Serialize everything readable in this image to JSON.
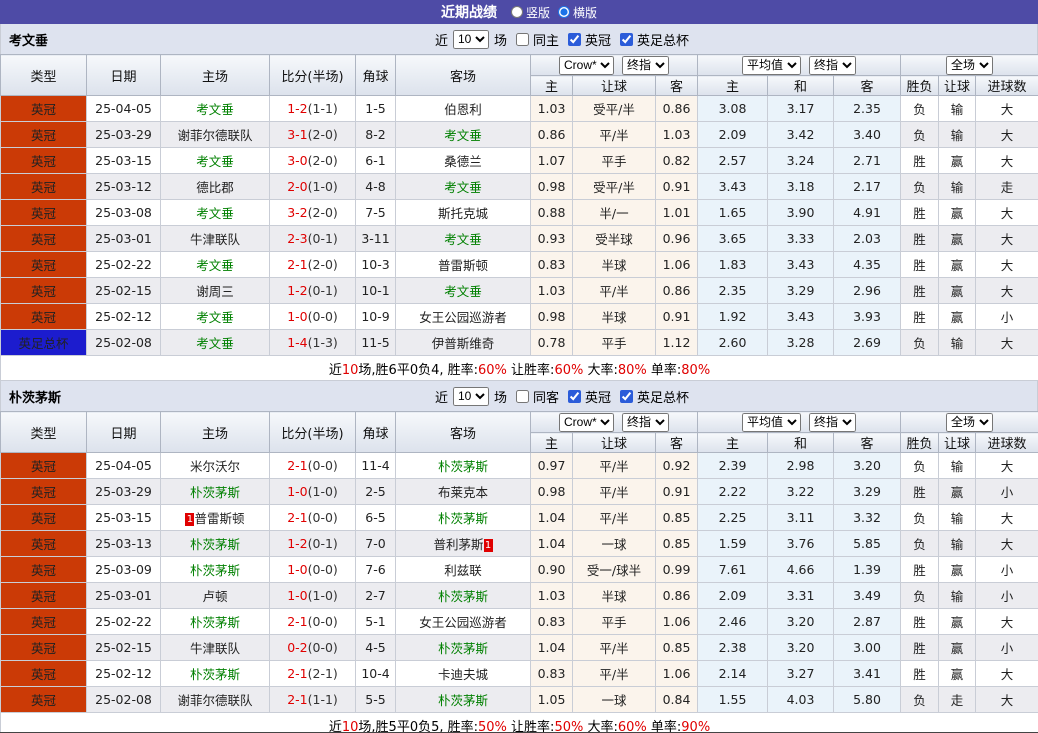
{
  "title_bar": {
    "title": "近期战绩",
    "radio_vertical": "竖版",
    "radio_horizontal": "横版",
    "selected": "横版"
  },
  "columns": {
    "left": [
      "类型",
      "日期",
      "主场",
      "比分(半场)",
      "角球",
      "客场"
    ],
    "handicap": [
      "主",
      "让球",
      "客"
    ],
    "europe": [
      "主",
      "和",
      "客"
    ],
    "result": [
      "胜负",
      "让球",
      "进球数"
    ]
  },
  "dropdowns": {
    "handicap_source": "Crow*",
    "handicap_final": "终指",
    "europe_source": "平均值",
    "europe_final": "终指",
    "scope": "全场"
  },
  "colors": {
    "accent_purple": "#4E4BA6",
    "badge_league": "#CB3A06",
    "badge_cup": "#1C1CCE",
    "focus_team_green": "#008000",
    "score_red": "#E00000",
    "win_red": "#DC4B42",
    "lose_blue": "#3B35CE",
    "push_green": "#2BA02B"
  },
  "teams": [
    {
      "name": "考文垂",
      "filter": {
        "near": "近",
        "games": "10",
        "unit": "场",
        "same": "同主",
        "same_checked": false,
        "league": "英冠",
        "league_checked": true,
        "cup": "英足总杯",
        "cup_checked": true
      },
      "rows": [
        {
          "league": "英冠",
          "league_style": "o",
          "date": "25-04-05",
          "home": "考文垂",
          "home_focus": true,
          "home_rc": "",
          "score": "1-2",
          "half": "(1-1)",
          "corner": "1-5",
          "away": "伯恩利",
          "away_focus": false,
          "away_rc": "",
          "h": [
            "1.03",
            "受平/半",
            "0.86"
          ],
          "e": [
            "3.08",
            "3.17",
            "2.35"
          ],
          "res": [
            [
              "负",
              "b"
            ],
            [
              "输",
              "b"
            ],
            [
              "大",
              "r"
            ]
          ]
        },
        {
          "league": "英冠",
          "league_style": "o",
          "date": "25-03-29",
          "home": "谢菲尔德联队",
          "home_focus": false,
          "home_rc": "",
          "score": "3-1",
          "half": "(2-0)",
          "corner": "8-2",
          "away": "考文垂",
          "away_focus": true,
          "away_rc": "",
          "h": [
            "0.86",
            "平/半",
            "1.03"
          ],
          "e": [
            "2.09",
            "3.42",
            "3.40"
          ],
          "res": [
            [
              "负",
              "b"
            ],
            [
              "输",
              "b"
            ],
            [
              "大",
              "r"
            ]
          ]
        },
        {
          "league": "英冠",
          "league_style": "o",
          "date": "25-03-15",
          "home": "考文垂",
          "home_focus": true,
          "home_rc": "",
          "score": "3-0",
          "half": "(2-0)",
          "corner": "6-1",
          "away": "桑德兰",
          "away_focus": false,
          "away_rc": "",
          "h": [
            "1.07",
            "平手",
            "0.82"
          ],
          "e": [
            "2.57",
            "3.24",
            "2.71"
          ],
          "res": [
            [
              "胜",
              "r"
            ],
            [
              "赢",
              "r"
            ],
            [
              "大",
              "r"
            ]
          ]
        },
        {
          "league": "英冠",
          "league_style": "o",
          "date": "25-03-12",
          "home": "德比郡",
          "home_focus": false,
          "home_rc": "",
          "score": "2-0",
          "half": "(1-0)",
          "corner": "4-8",
          "away": "考文垂",
          "away_focus": true,
          "away_rc": "",
          "h": [
            "0.98",
            "受平/半",
            "0.91"
          ],
          "e": [
            "3.43",
            "3.18",
            "2.17"
          ],
          "res": [
            [
              "负",
              "b"
            ],
            [
              "输",
              "b"
            ],
            [
              "走",
              "g"
            ]
          ]
        },
        {
          "league": "英冠",
          "league_style": "o",
          "date": "25-03-08",
          "home": "考文垂",
          "home_focus": true,
          "home_rc": "",
          "score": "3-2",
          "half": "(2-0)",
          "corner": "7-5",
          "away": "斯托克城",
          "away_focus": false,
          "away_rc": "",
          "h": [
            "0.88",
            "半/一",
            "1.01"
          ],
          "e": [
            "1.65",
            "3.90",
            "4.91"
          ],
          "res": [
            [
              "胜",
              "r"
            ],
            [
              "赢",
              "r"
            ],
            [
              "大",
              "r"
            ]
          ]
        },
        {
          "league": "英冠",
          "league_style": "o",
          "date": "25-03-01",
          "home": "牛津联队",
          "home_focus": false,
          "home_rc": "",
          "score": "2-3",
          "half": "(0-1)",
          "corner": "3-11",
          "away": "考文垂",
          "away_focus": true,
          "away_rc": "",
          "h": [
            "0.93",
            "受半球",
            "0.96"
          ],
          "e": [
            "3.65",
            "3.33",
            "2.03"
          ],
          "res": [
            [
              "胜",
              "r"
            ],
            [
              "赢",
              "r"
            ],
            [
              "大",
              "r"
            ]
          ]
        },
        {
          "league": "英冠",
          "league_style": "o",
          "date": "25-02-22",
          "home": "考文垂",
          "home_focus": true,
          "home_rc": "",
          "score": "2-1",
          "half": "(2-0)",
          "corner": "10-3",
          "away": "普雷斯顿",
          "away_focus": false,
          "away_rc": "",
          "h": [
            "0.83",
            "半球",
            "1.06"
          ],
          "e": [
            "1.83",
            "3.43",
            "4.35"
          ],
          "res": [
            [
              "胜",
              "r"
            ],
            [
              "赢",
              "r"
            ],
            [
              "大",
              "r"
            ]
          ]
        },
        {
          "league": "英冠",
          "league_style": "o",
          "date": "25-02-15",
          "home": "谢周三",
          "home_focus": false,
          "home_rc": "",
          "score": "1-2",
          "half": "(0-1)",
          "corner": "10-1",
          "away": "考文垂",
          "away_focus": true,
          "away_rc": "",
          "h": [
            "1.03",
            "平/半",
            "0.86"
          ],
          "e": [
            "2.35",
            "3.29",
            "2.96"
          ],
          "res": [
            [
              "胜",
              "r"
            ],
            [
              "赢",
              "r"
            ],
            [
              "大",
              "r"
            ]
          ]
        },
        {
          "league": "英冠",
          "league_style": "o",
          "date": "25-02-12",
          "home": "考文垂",
          "home_focus": true,
          "home_rc": "",
          "score": "1-0",
          "half": "(0-0)",
          "corner": "10-9",
          "away": "女王公园巡游者",
          "away_focus": false,
          "away_rc": "",
          "h": [
            "0.98",
            "半球",
            "0.91"
          ],
          "e": [
            "1.92",
            "3.43",
            "3.93"
          ],
          "res": [
            [
              "胜",
              "r"
            ],
            [
              "赢",
              "r"
            ],
            [
              "小",
              "b"
            ]
          ]
        },
        {
          "league": "英足总杯",
          "league_style": "b",
          "date": "25-02-08",
          "home": "考文垂",
          "home_focus": true,
          "home_rc": "",
          "score": "1-4",
          "half": "(1-3)",
          "corner": "11-5",
          "away": "伊普斯维奇",
          "away_focus": false,
          "away_rc": "",
          "h": [
            "0.78",
            "平手",
            "1.12"
          ],
          "e": [
            "2.60",
            "3.28",
            "2.69"
          ],
          "res": [
            [
              "负",
              "b"
            ],
            [
              "输",
              "b"
            ],
            [
              "大",
              "r"
            ]
          ]
        }
      ],
      "summary": [
        [
          "近",
          "k"
        ],
        [
          "10",
          "r"
        ],
        [
          "场,胜6平0负4, 胜率:",
          "k"
        ],
        [
          "60%",
          "r"
        ],
        [
          " 让胜率:",
          "k"
        ],
        [
          "60%",
          "r"
        ],
        [
          " 大率:",
          "k"
        ],
        [
          "80%",
          "r"
        ],
        [
          " 单率:",
          "k"
        ],
        [
          "80%",
          "r"
        ]
      ]
    },
    {
      "name": "朴茨茅斯",
      "filter": {
        "near": "近",
        "games": "10",
        "unit": "场",
        "same": "同客",
        "same_checked": false,
        "league": "英冠",
        "league_checked": true,
        "cup": "英足总杯",
        "cup_checked": true
      },
      "rows": [
        {
          "league": "英冠",
          "league_style": "o",
          "date": "25-04-05",
          "home": "米尔沃尔",
          "home_focus": false,
          "home_rc": "",
          "score": "2-1",
          "half": "(0-0)",
          "corner": "11-4",
          "away": "朴茨茅斯",
          "away_focus": true,
          "away_rc": "",
          "h": [
            "0.97",
            "平/半",
            "0.92"
          ],
          "e": [
            "2.39",
            "2.98",
            "3.20"
          ],
          "res": [
            [
              "负",
              "b"
            ],
            [
              "输",
              "b"
            ],
            [
              "大",
              "r"
            ]
          ]
        },
        {
          "league": "英冠",
          "league_style": "o",
          "date": "25-03-29",
          "home": "朴茨茅斯",
          "home_focus": true,
          "home_rc": "",
          "score": "1-0",
          "half": "(1-0)",
          "corner": "2-5",
          "away": "布莱克本",
          "away_focus": false,
          "away_rc": "",
          "h": [
            "0.98",
            "平/半",
            "0.91"
          ],
          "e": [
            "2.22",
            "3.22",
            "3.29"
          ],
          "res": [
            [
              "胜",
              "r"
            ],
            [
              "赢",
              "r"
            ],
            [
              "小",
              "b"
            ]
          ]
        },
        {
          "league": "英冠",
          "league_style": "o",
          "date": "25-03-15",
          "home": "普雷斯顿",
          "home_focus": false,
          "home_rc": "1",
          "score": "2-1",
          "half": "(0-0)",
          "corner": "6-5",
          "away": "朴茨茅斯",
          "away_focus": true,
          "away_rc": "",
          "h": [
            "1.04",
            "平/半",
            "0.85"
          ],
          "e": [
            "2.25",
            "3.11",
            "3.32"
          ],
          "res": [
            [
              "负",
              "b"
            ],
            [
              "输",
              "b"
            ],
            [
              "大",
              "r"
            ]
          ]
        },
        {
          "league": "英冠",
          "league_style": "o",
          "date": "25-03-13",
          "home": "朴茨茅斯",
          "home_focus": true,
          "home_rc": "",
          "score": "1-2",
          "half": "(0-1)",
          "corner": "7-0",
          "away": "普利茅斯",
          "away_focus": false,
          "away_rc": "1",
          "h": [
            "1.04",
            "一球",
            "0.85"
          ],
          "e": [
            "1.59",
            "3.76",
            "5.85"
          ],
          "res": [
            [
              "负",
              "b"
            ],
            [
              "输",
              "b"
            ],
            [
              "大",
              "r"
            ]
          ]
        },
        {
          "league": "英冠",
          "league_style": "o",
          "date": "25-03-09",
          "home": "朴茨茅斯",
          "home_focus": true,
          "home_rc": "",
          "score": "1-0",
          "half": "(0-0)",
          "corner": "7-6",
          "away": "利兹联",
          "away_focus": false,
          "away_rc": "",
          "h": [
            "0.90",
            "受一/球半",
            "0.99"
          ],
          "e": [
            "7.61",
            "4.66",
            "1.39"
          ],
          "res": [
            [
              "胜",
              "r"
            ],
            [
              "赢",
              "r"
            ],
            [
              "小",
              "b"
            ]
          ]
        },
        {
          "league": "英冠",
          "league_style": "o",
          "date": "25-03-01",
          "home": "卢顿",
          "home_focus": false,
          "home_rc": "",
          "score": "1-0",
          "half": "(1-0)",
          "corner": "2-7",
          "away": "朴茨茅斯",
          "away_focus": true,
          "away_rc": "",
          "h": [
            "1.03",
            "半球",
            "0.86"
          ],
          "e": [
            "2.09",
            "3.31",
            "3.49"
          ],
          "res": [
            [
              "负",
              "b"
            ],
            [
              "输",
              "b"
            ],
            [
              "小",
              "b"
            ]
          ]
        },
        {
          "league": "英冠",
          "league_style": "o",
          "date": "25-02-22",
          "home": "朴茨茅斯",
          "home_focus": true,
          "home_rc": "",
          "score": "2-1",
          "half": "(0-0)",
          "corner": "5-1",
          "away": "女王公园巡游者",
          "away_focus": false,
          "away_rc": "",
          "h": [
            "0.83",
            "平手",
            "1.06"
          ],
          "e": [
            "2.46",
            "3.20",
            "2.87"
          ],
          "res": [
            [
              "胜",
              "r"
            ],
            [
              "赢",
              "r"
            ],
            [
              "大",
              "r"
            ]
          ]
        },
        {
          "league": "英冠",
          "league_style": "o",
          "date": "25-02-15",
          "home": "牛津联队",
          "home_focus": false,
          "home_rc": "",
          "score": "0-2",
          "half": "(0-0)",
          "corner": "4-5",
          "away": "朴茨茅斯",
          "away_focus": true,
          "away_rc": "",
          "h": [
            "1.04",
            "平/半",
            "0.85"
          ],
          "e": [
            "2.38",
            "3.20",
            "3.00"
          ],
          "res": [
            [
              "胜",
              "r"
            ],
            [
              "赢",
              "r"
            ],
            [
              "小",
              "b"
            ]
          ]
        },
        {
          "league": "英冠",
          "league_style": "o",
          "date": "25-02-12",
          "home": "朴茨茅斯",
          "home_focus": true,
          "home_rc": "",
          "score": "2-1",
          "half": "(2-1)",
          "corner": "10-4",
          "away": "卡迪夫城",
          "away_focus": false,
          "away_rc": "",
          "h": [
            "0.83",
            "平/半",
            "1.06"
          ],
          "e": [
            "2.14",
            "3.27",
            "3.41"
          ],
          "res": [
            [
              "胜",
              "r"
            ],
            [
              "赢",
              "r"
            ],
            [
              "大",
              "r"
            ]
          ]
        },
        {
          "league": "英冠",
          "league_style": "o",
          "date": "25-02-08",
          "home": "谢菲尔德联队",
          "home_focus": false,
          "home_rc": "",
          "score": "2-1",
          "half": "(1-1)",
          "corner": "5-5",
          "away": "朴茨茅斯",
          "away_focus": true,
          "away_rc": "",
          "h": [
            "1.05",
            "一球",
            "0.84"
          ],
          "e": [
            "1.55",
            "4.03",
            "5.80"
          ],
          "res": [
            [
              "负",
              "b"
            ],
            [
              "走",
              "g"
            ],
            [
              "大",
              "r"
            ]
          ]
        }
      ],
      "summary": [
        [
          "近",
          "k"
        ],
        [
          "10",
          "r"
        ],
        [
          "场,胜5平0负5, 胜率:",
          "k"
        ],
        [
          "50%",
          "r"
        ],
        [
          " 让胜率:",
          "k"
        ],
        [
          "50%",
          "r"
        ],
        [
          " 大率:",
          "k"
        ],
        [
          "60%",
          "r"
        ],
        [
          " 单率:",
          "k"
        ],
        [
          "90%",
          "r"
        ]
      ]
    }
  ]
}
